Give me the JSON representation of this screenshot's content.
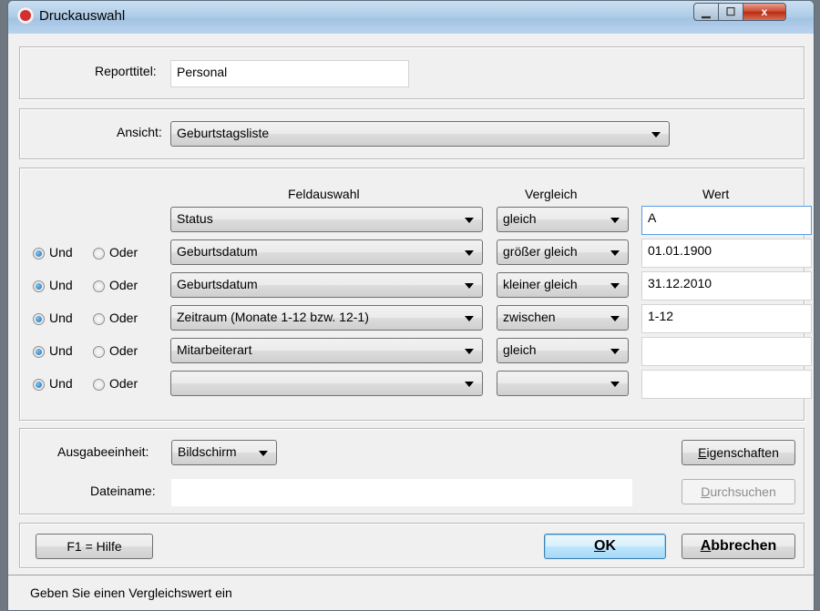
{
  "window": {
    "title": "Druckauswahl",
    "icon": "app-logo-icon",
    "close_glyph": "x"
  },
  "report": {
    "label": "Reporttitel:",
    "value": "Personal"
  },
  "view": {
    "label": "Ansicht:",
    "value": "Geburtstagsliste"
  },
  "filter": {
    "headers": {
      "field": "Feldauswahl",
      "compare": "Vergleich",
      "value": "Wert"
    },
    "and_label": "Und",
    "or_label": "Oder",
    "rows": [
      {
        "field": "Status",
        "compare": "gleich",
        "value": "A"
      },
      {
        "field": "Geburtsdatum",
        "compare": "größer gleich",
        "value": "01.01.1900"
      },
      {
        "field": "Geburtsdatum",
        "compare": "kleiner gleich",
        "value": "31.12.2010"
      },
      {
        "field": "Zeitraum (Monate 1-12 bzw. 12-1)",
        "compare": "zwischen",
        "value": "1-12"
      },
      {
        "field": "Mitarbeiterart",
        "compare": "gleich",
        "value": ""
      },
      {
        "field": "",
        "compare": "",
        "value": ""
      }
    ]
  },
  "output": {
    "unit_label": "Ausgabeeinheit:",
    "unit_value": "Bildschirm",
    "properties_button": {
      "mnemonic": "E",
      "rest": "igenschaften"
    },
    "filename_label": "Dateiname:",
    "filename_value": "",
    "browse_button": {
      "mnemonic": "D",
      "rest": "urchsuchen"
    }
  },
  "buttons": {
    "help": "F1 = Hilfe",
    "ok": {
      "mnemonic": "O",
      "rest": "K"
    },
    "cancel": {
      "mnemonic": "A",
      "rest": "bbrechen"
    }
  },
  "status": {
    "text": "Geben Sie einen Vergleichswert ein"
  }
}
